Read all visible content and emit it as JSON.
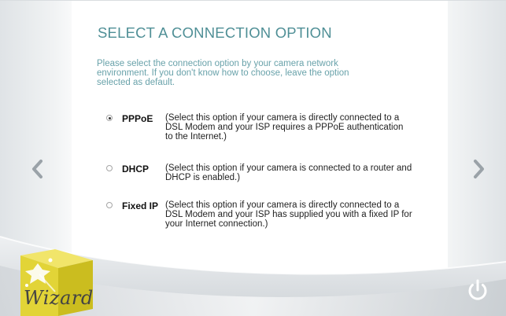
{
  "header": {
    "title": "SELECT A CONNECTION OPTION"
  },
  "instructions": "Please select the connection option by your camera network environment. If you don't know how to choose, leave the option selected as default.",
  "options": [
    {
      "label": "PPPoE",
      "selected": true,
      "description": "(Select this option if your camera is directly connected to a DSL Modem and your ISP requires a PPPoE authentication to the Internet.)"
    },
    {
      "label": "DHCP",
      "selected": false,
      "description": "(Select this option if your camera is connected to a router and DHCP is enabled.)"
    },
    {
      "label": "Fixed IP",
      "selected": false,
      "description": "(Select this option if your camera is directly connected to a DSL Modem and your ISP has supplied you with a fixed IP for your Internet connection.)"
    }
  ],
  "navigation": {
    "back_icon": "chevron-left-icon",
    "next_icon": "chevron-right-icon",
    "power_icon": "power-icon"
  },
  "logo": {
    "text": "Wizard",
    "icon": "magic-box-icon"
  },
  "colors": {
    "title": "#4f8f96",
    "instructions": "#69a2aa",
    "logo_box": "#e2d437",
    "power": "#ffffff"
  }
}
